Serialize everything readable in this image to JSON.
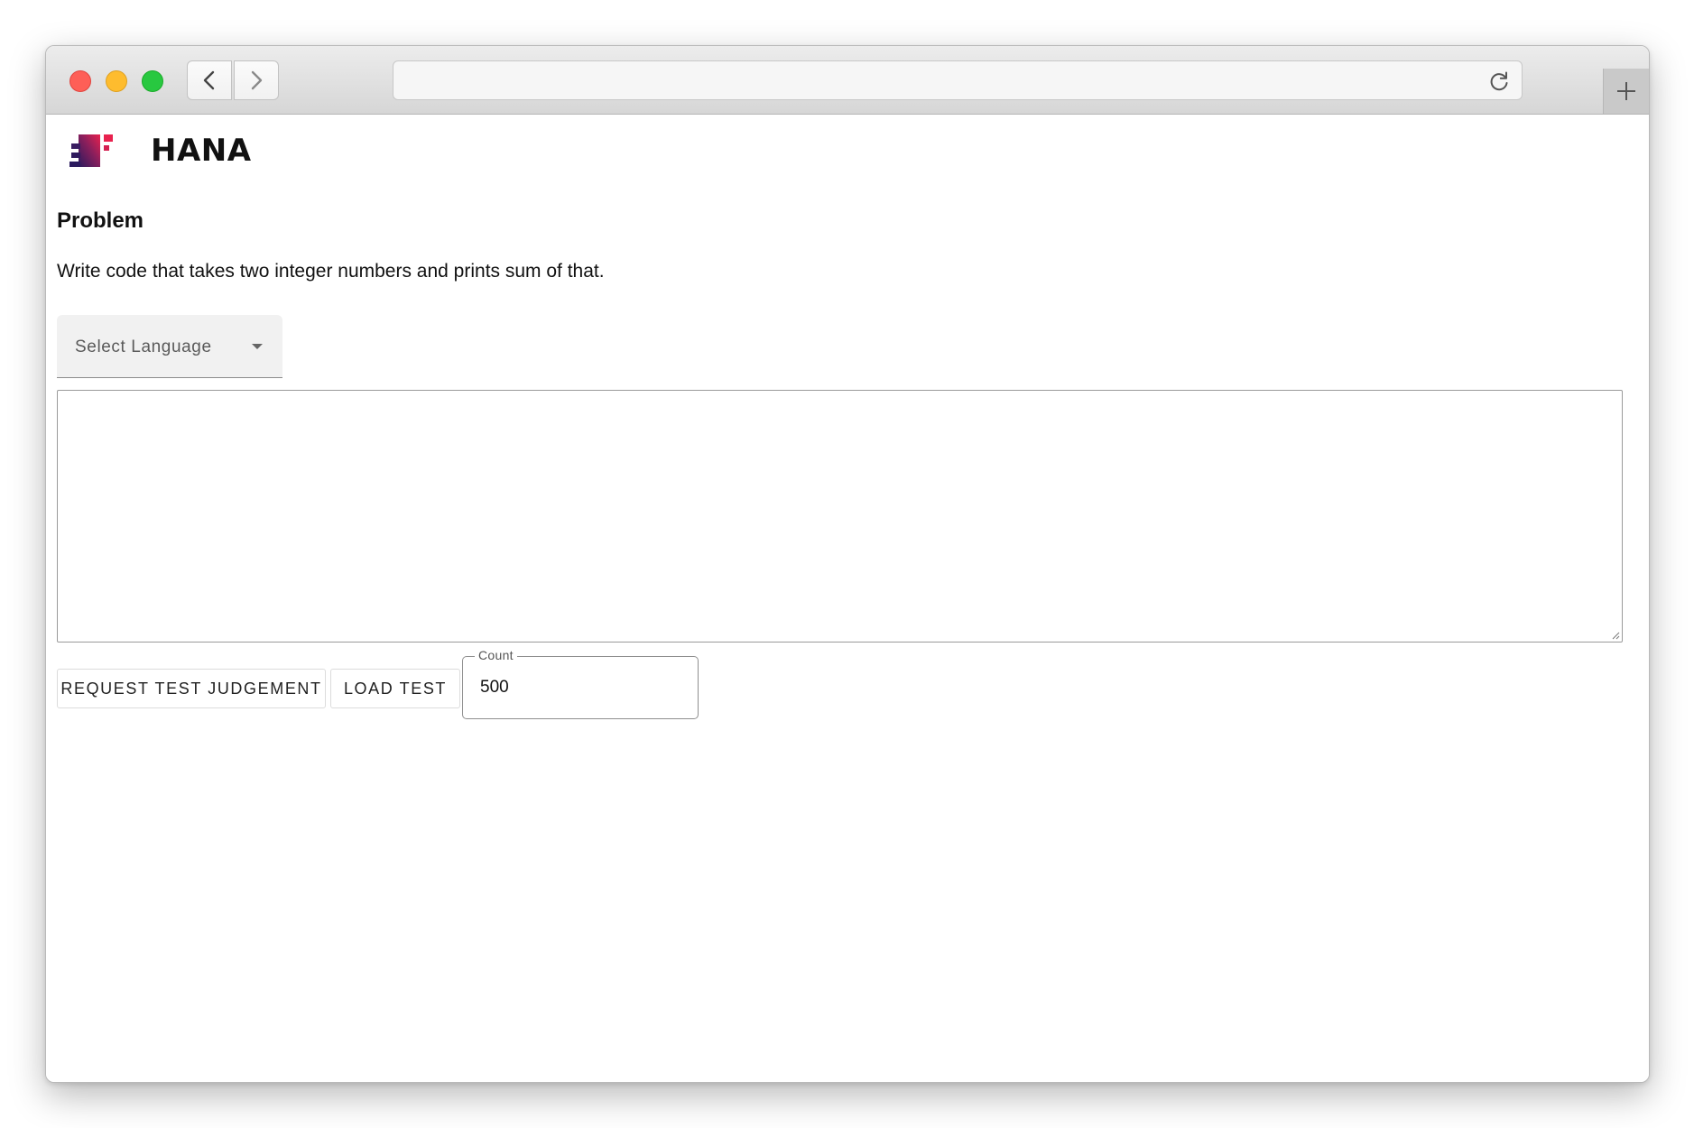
{
  "browser": {
    "url": "",
    "icons": {
      "back": "chevron-left-icon",
      "forward": "chevron-right-icon",
      "reload": "reload-icon",
      "new_tab": "plus-icon"
    }
  },
  "header": {
    "brand_name": "HANA",
    "logo_colors": [
      "#2b1a5e",
      "#8a1f5c",
      "#e8214e"
    ]
  },
  "problem": {
    "title": "Problem",
    "description": "Write code that takes two integer numbers and prints sum of that."
  },
  "language_select": {
    "label": "Select Language",
    "icon": "caret-down-icon"
  },
  "editor": {
    "value": ""
  },
  "actions": {
    "request_label": "REQUEST TEST JUDGEMENT",
    "load_label": "LOAD TEST",
    "count_label": "Count",
    "count_value": "500"
  }
}
